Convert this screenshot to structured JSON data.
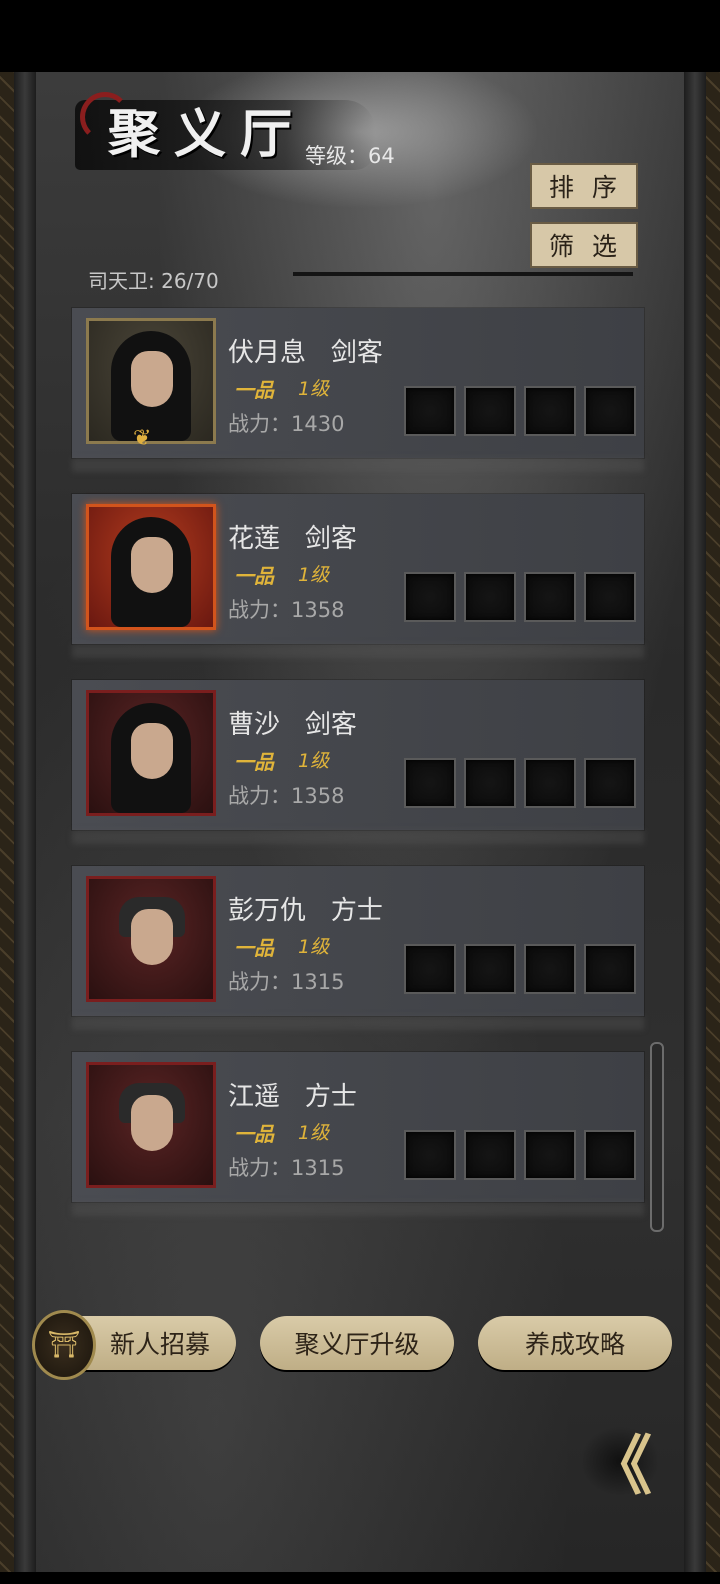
{
  "header": {
    "title": "聚义厅",
    "level_label": "等级：64",
    "capacity_label": "司天卫: 26/70",
    "sort_label": "排序",
    "filter_label": "筛选"
  },
  "heroes": [
    {
      "name": "伏月息",
      "role": "剑客",
      "rank": "一品",
      "level": "1级",
      "power": "战力：1430",
      "frame": "gold",
      "emblem": "❦"
    },
    {
      "name": "花莲",
      "role": "剑客",
      "rank": "一品",
      "level": "1级",
      "power": "战力：1358",
      "frame": "orange"
    },
    {
      "name": "曹沙",
      "role": "剑客",
      "rank": "一品",
      "level": "1级",
      "power": "战力：1358",
      "frame": "red"
    },
    {
      "name": "彭万仇",
      "role": "方士",
      "rank": "一品",
      "level": "1级",
      "power": "战力：1315",
      "frame": "red"
    },
    {
      "name": "江遥",
      "role": "方士",
      "rank": "一品",
      "level": "1级",
      "power": "战力：1315",
      "frame": "red"
    }
  ],
  "footer": {
    "recruit_label": "新人招募",
    "upgrade_label": "聚义厅升级",
    "guide_label": "养成攻略"
  },
  "back_glyph": "《",
  "colors": {
    "accent_gold": "#e0b43a",
    "button_bg": "#d7c8a8"
  }
}
